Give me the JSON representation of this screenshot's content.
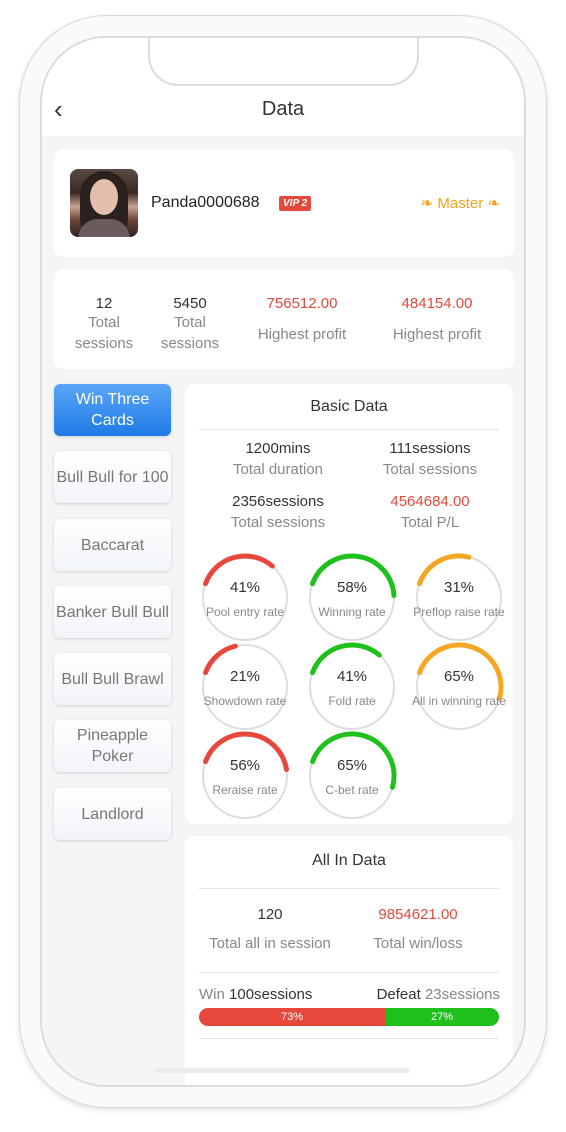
{
  "nav": {
    "back_icon": "chevron-left-icon",
    "title": "Data"
  },
  "profile": {
    "username": "Panda0000688",
    "vip_badge": "VIP 2",
    "rank": "Master"
  },
  "summary": [
    {
      "value": "12",
      "label": "Total sessions",
      "color": "#333333"
    },
    {
      "value": "5450",
      "label": "Total sessions",
      "color": "#333333"
    },
    {
      "value": "756512.00",
      "label": "Highest profit",
      "color": "#e34a3c"
    },
    {
      "value": "484154.00",
      "label": "Highest profit",
      "color": "#e34a3c"
    }
  ],
  "games": [
    {
      "label": "Win Three Cards",
      "active": true
    },
    {
      "label": "Bull Bull for 100",
      "active": false
    },
    {
      "label": "Baccarat",
      "active": false
    },
    {
      "label": "Banker Bull Bull",
      "active": false
    },
    {
      "label": "Bull Bull Brawl",
      "active": false
    },
    {
      "label": "Pineapple Poker",
      "active": false
    },
    {
      "label": "Landlord",
      "active": false
    }
  ],
  "basic": {
    "title": "Basic Data",
    "cells": [
      {
        "value": "1200mins",
        "label": "Total duration"
      },
      {
        "value": "111sessions",
        "label": "Total sessions"
      },
      {
        "value": "2356sessions",
        "label": "Total sessions"
      },
      {
        "value": "4564684.00",
        "label": "Total P/L"
      }
    ],
    "gauges": [
      {
        "pct": "41%",
        "value": 0.41,
        "label": "Pool entry rate",
        "color": "#e8483c"
      },
      {
        "pct": "58%",
        "value": 0.58,
        "label": "Winning rate",
        "color": "#1ec11b"
      },
      {
        "pct": "31%",
        "value": 0.31,
        "label": "Preflop raise rate",
        "color": "#f5a623"
      },
      {
        "pct": "21%",
        "value": 0.21,
        "label": "Showdown rate",
        "color": "#e8483c"
      },
      {
        "pct": "41%",
        "value": 0.41,
        "label": "Fold rate",
        "color": "#1ec11b"
      },
      {
        "pct": "65%",
        "value": 0.65,
        "label": "All in winning rate",
        "color": "#f5a623"
      },
      {
        "pct": "56%",
        "value": 0.56,
        "label": "Reraise rate",
        "color": "#e8483c"
      },
      {
        "pct": "65%",
        "value": 0.65,
        "label": "C-bet rate",
        "color": "#1ec11b"
      }
    ]
  },
  "allin": {
    "title": "All In Data",
    "cells": [
      {
        "value": "120",
        "label": "Total all in session"
      },
      {
        "value": "9854621.00",
        "label": "Total win/loss"
      }
    ],
    "win_label": "Win",
    "win_value": "100sessions",
    "defeat_label": "Defeat",
    "defeat_value": "23sessions",
    "win_pct": "73%",
    "defeat_pct": "27%",
    "win_fraction": 0.62
  }
}
